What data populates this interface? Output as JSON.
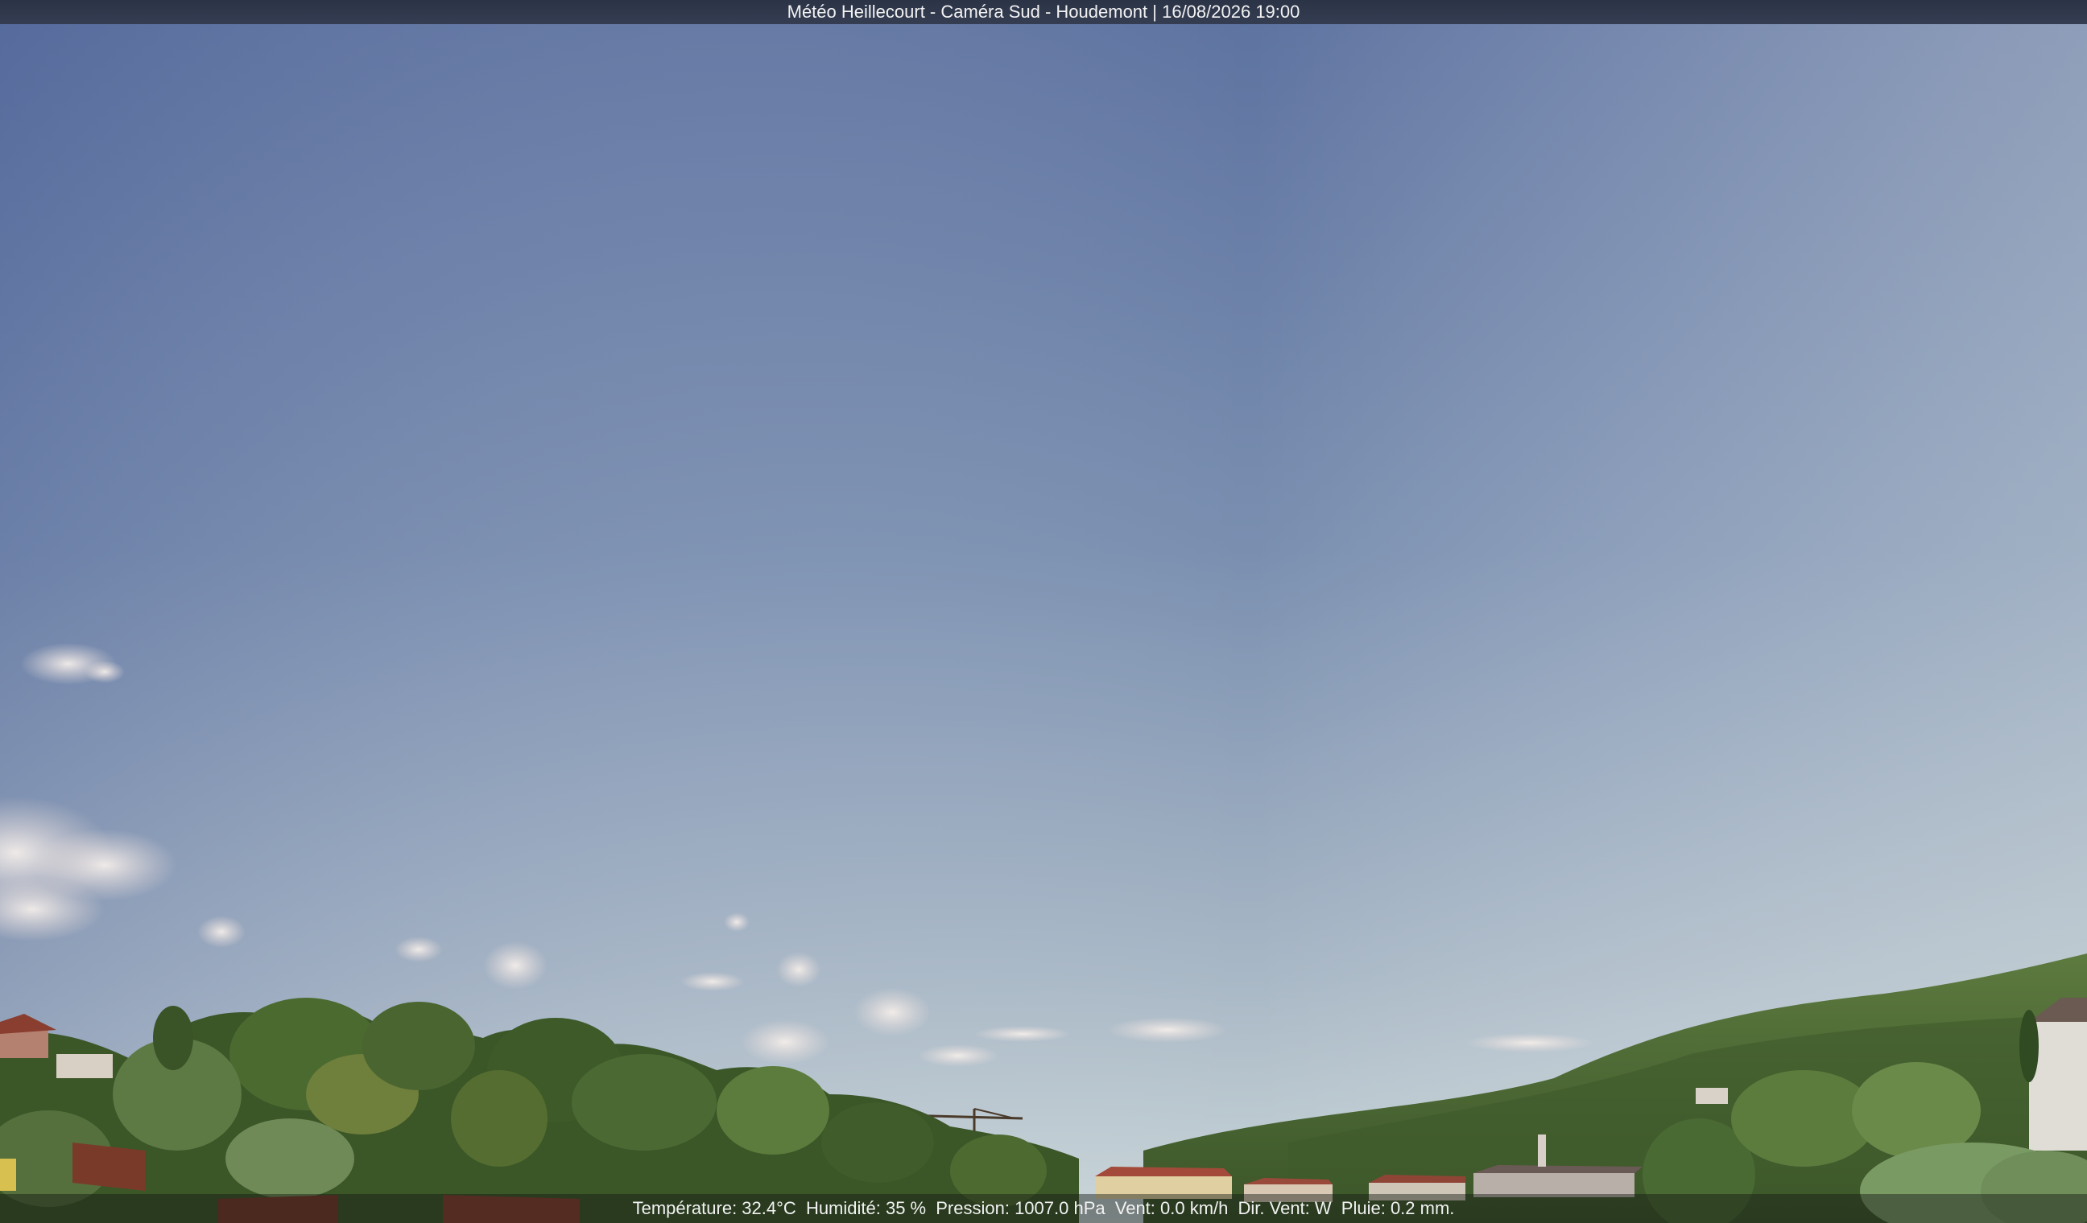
{
  "header": {
    "caption": "Météo Heillecourt - Caméra Sud - Houdemont | 16/08/2026 19:00"
  },
  "readings": {
    "temperature": "Température: 32.4°C",
    "humidity": "Humidité: 35 %",
    "pressure": "Pression: 1007.0 hPa",
    "wind": "Vent: 0.0 km/h",
    "wind_dir": "Dir. Vent: W",
    "rain": "Pluie: 0.2 mm."
  },
  "colors": {
    "sky_top": "#5d72a0",
    "sky_mid": "#8a9db8",
    "sky_horizon": "#c4d2d8",
    "foliage_dark": "#2f4a22",
    "foliage_light": "#6e8a44",
    "roof": "#9a4a3a"
  }
}
